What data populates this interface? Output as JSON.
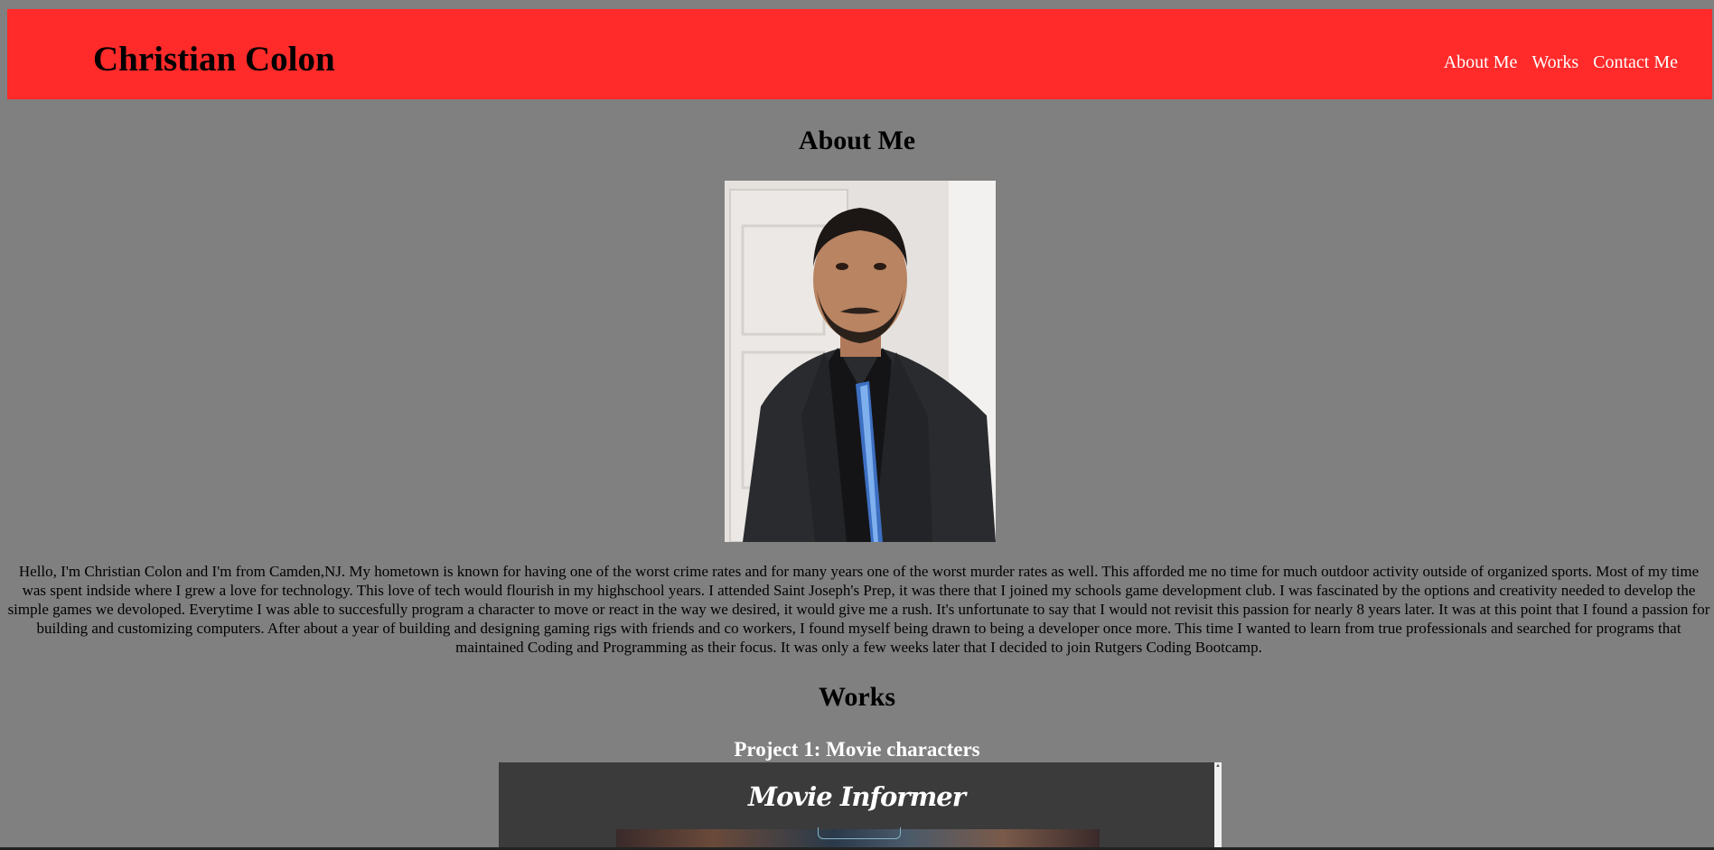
{
  "header": {
    "site_title": "Christian Colon",
    "nav": [
      "About Me",
      "Works",
      "Contact Me"
    ]
  },
  "about": {
    "title": "About Me",
    "bio": "Hello, I'm Christian Colon and I'm from Camden,NJ. My hometown is known for having one of the worst crime rates and for many years one of the worst murder rates as well. This afforded me no time for much outdoor activity outside of organized sports. Most of my time was spent indside where I grew a love for technology. This love of tech would flourish in my highschool years. I attended Saint Joseph's Prep, it was there that I joined my schools game development club. I was fascinated by the options and creativity needed to develop the simple games we devoloped. Everytime I was able to succesfully program a character to move or react in the way we desired, it would give me a rush. It's unfortunate to say that I would not revisit this passion for nearly 8 years later. It was at this point that I found a passion for building and customizing computers. After about a year of building and designing gaming rigs with friends and co workers, I found myself being drawn to being a developer once more. This time I wanted to learn from true professionals and searched for programs that maintained Coding and Programming as their focus. It was only a few weeks later that I decided to join Rutgers Coding Bootcamp."
  },
  "works": {
    "title": "Works",
    "projects": [
      {
        "title": "Project 1: Movie characters",
        "app_title": "Movie Informer"
      }
    ]
  },
  "colors": {
    "page_background": "#808080",
    "header_background": "#ff2a2a",
    "nav_text": "#ffffff",
    "project_frame": "#3b3b3b"
  }
}
